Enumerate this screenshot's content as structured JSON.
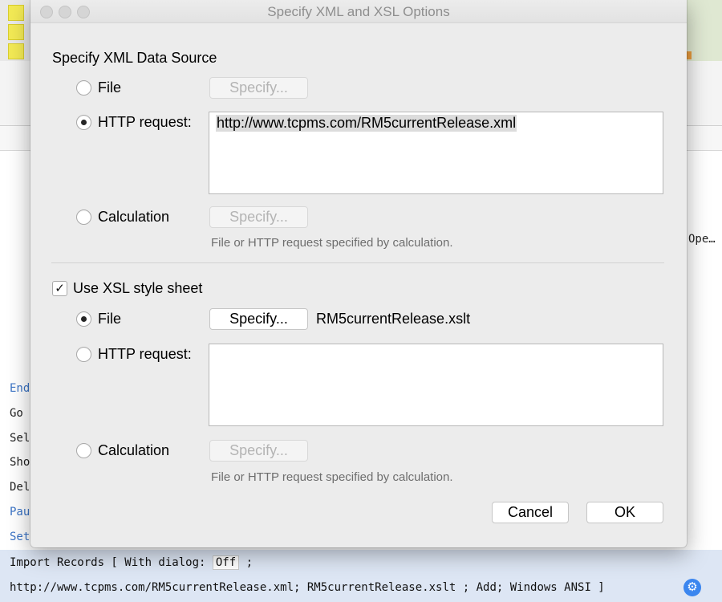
{
  "background": {
    "partial_ope": "Ope… )",
    "script_lines": [
      {
        "text": "End",
        "color": "blue"
      },
      {
        "text": "Go ",
        "color": "black"
      },
      {
        "text": "Sel",
        "color": "black"
      },
      {
        "text": "Sho",
        "color": "black"
      },
      {
        "text": "Del",
        "color": "black"
      },
      {
        "text": "Pau",
        "color": "blue"
      },
      {
        "text": "Set",
        "color": "blue"
      }
    ],
    "selected_step": {
      "line1_prefix": "Import Records [ With dialog: ",
      "dialog_value": "Off",
      "line1_suffix": " ;",
      "line2": "http://www.tcpms.com/RM5currentRelease.xml; RM5currentRelease.xslt ; Add; Windows ANSI ]"
    },
    "gear_icon": "gear-icon"
  },
  "dialog": {
    "title": "Specify XML and XSL Options",
    "xml_section": {
      "heading": "Specify XML Data Source",
      "file_label": "File",
      "file_button": "Specify...",
      "http_label": "HTTP request:",
      "http_value": "http://www.tcpms.com/RM5currentRelease.xml",
      "calc_label": "Calculation",
      "calc_button": "Specify...",
      "help_text": "File or HTTP request specified by calculation.",
      "selected": "http"
    },
    "xsl_section": {
      "checkbox_label": "Use XSL style sheet",
      "checked": true,
      "file_label": "File",
      "file_button": "Specify...",
      "file_name": "RM5currentRelease.xslt",
      "http_label": "HTTP request:",
      "http_value": "",
      "calc_label": "Calculation",
      "calc_button": "Specify...",
      "help_text": "File or HTTP request specified by calculation.",
      "selected": "file"
    },
    "cancel_label": "Cancel",
    "ok_label": "OK"
  }
}
